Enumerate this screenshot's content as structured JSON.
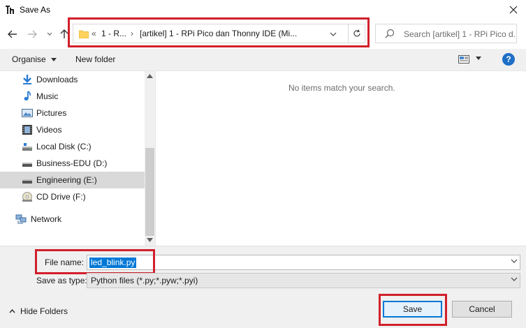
{
  "window": {
    "title": "Save As",
    "close_icon": "close-icon"
  },
  "nav": {
    "breadcrumb_overflow": "«",
    "crumbs": [
      "1 - R...",
      "[artikel] 1 - RPi Pico dan Thonny IDE (Mi..."
    ],
    "search_placeholder": "Search [artikel] 1 - RPi Pico d..."
  },
  "toolbar": {
    "organise_label": "Organise",
    "new_folder_label": "New folder",
    "help_label": "?"
  },
  "sidebar": {
    "items": [
      {
        "label": "Downloads",
        "icon": "download-arrow-icon"
      },
      {
        "label": "Music",
        "icon": "music-note-icon"
      },
      {
        "label": "Pictures",
        "icon": "pictures-icon"
      },
      {
        "label": "Videos",
        "icon": "videos-icon"
      },
      {
        "label": "Local Disk (C:)",
        "icon": "local-disk-icon"
      },
      {
        "label": "Business-EDU (D:)",
        "icon": "drive-icon"
      },
      {
        "label": "Engineering (E:)",
        "icon": "drive-icon",
        "selected": true
      },
      {
        "label": "CD Drive (F:)",
        "icon": "cd-drive-icon"
      },
      {
        "label": "Network",
        "icon": "network-icon"
      }
    ]
  },
  "content": {
    "empty_message": "No items match your search."
  },
  "form": {
    "file_name_label": "File name:",
    "file_name_value": "led_blink.py",
    "save_type_label": "Save as type:",
    "save_type_value": "Python files (*.py;*.pyw;*.pyi)",
    "hide_folders_label": "Hide Folders",
    "save_label": "Save",
    "cancel_label": "Cancel"
  },
  "colors": {
    "highlight_outline": "#d1202b",
    "accent": "#0078d7"
  }
}
